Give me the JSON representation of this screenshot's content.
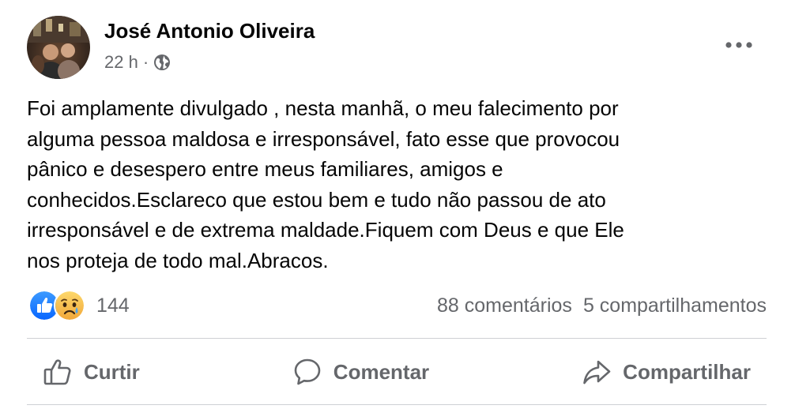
{
  "post": {
    "author": "José Antonio Oliveira",
    "time": "22 h",
    "separator": "·",
    "privacy_icon": "globe-icon",
    "more_icon": "more-options-icon",
    "text": "Foi amplamente divulgado , nesta manhã, o meu falecimento por\nalguma pessoa maldosa e irresponsável, fato esse que provocou\npânico e desespero entre meus familiares, amigos e\nconhecidos.Esclareco que estou bem e tudo não passou de ato\nirresponsável e de extrema maldade.Fiquem com Deus e que Ele\nnos proteja de todo mal.Abracos."
  },
  "reactions": {
    "icons": [
      "like-icon",
      "sad-icon"
    ],
    "count": "144",
    "comments": "88 comentários",
    "shares": "5 compartilhamentos"
  },
  "actions": {
    "like_label": "Curtir",
    "comment_label": "Comentar",
    "share_label": "Compartilhar"
  },
  "colors": {
    "like_blue": "#1877f2",
    "sad_yellow": "#f7c33a",
    "secondary_text": "#65676b",
    "divider": "#ced0d4"
  }
}
